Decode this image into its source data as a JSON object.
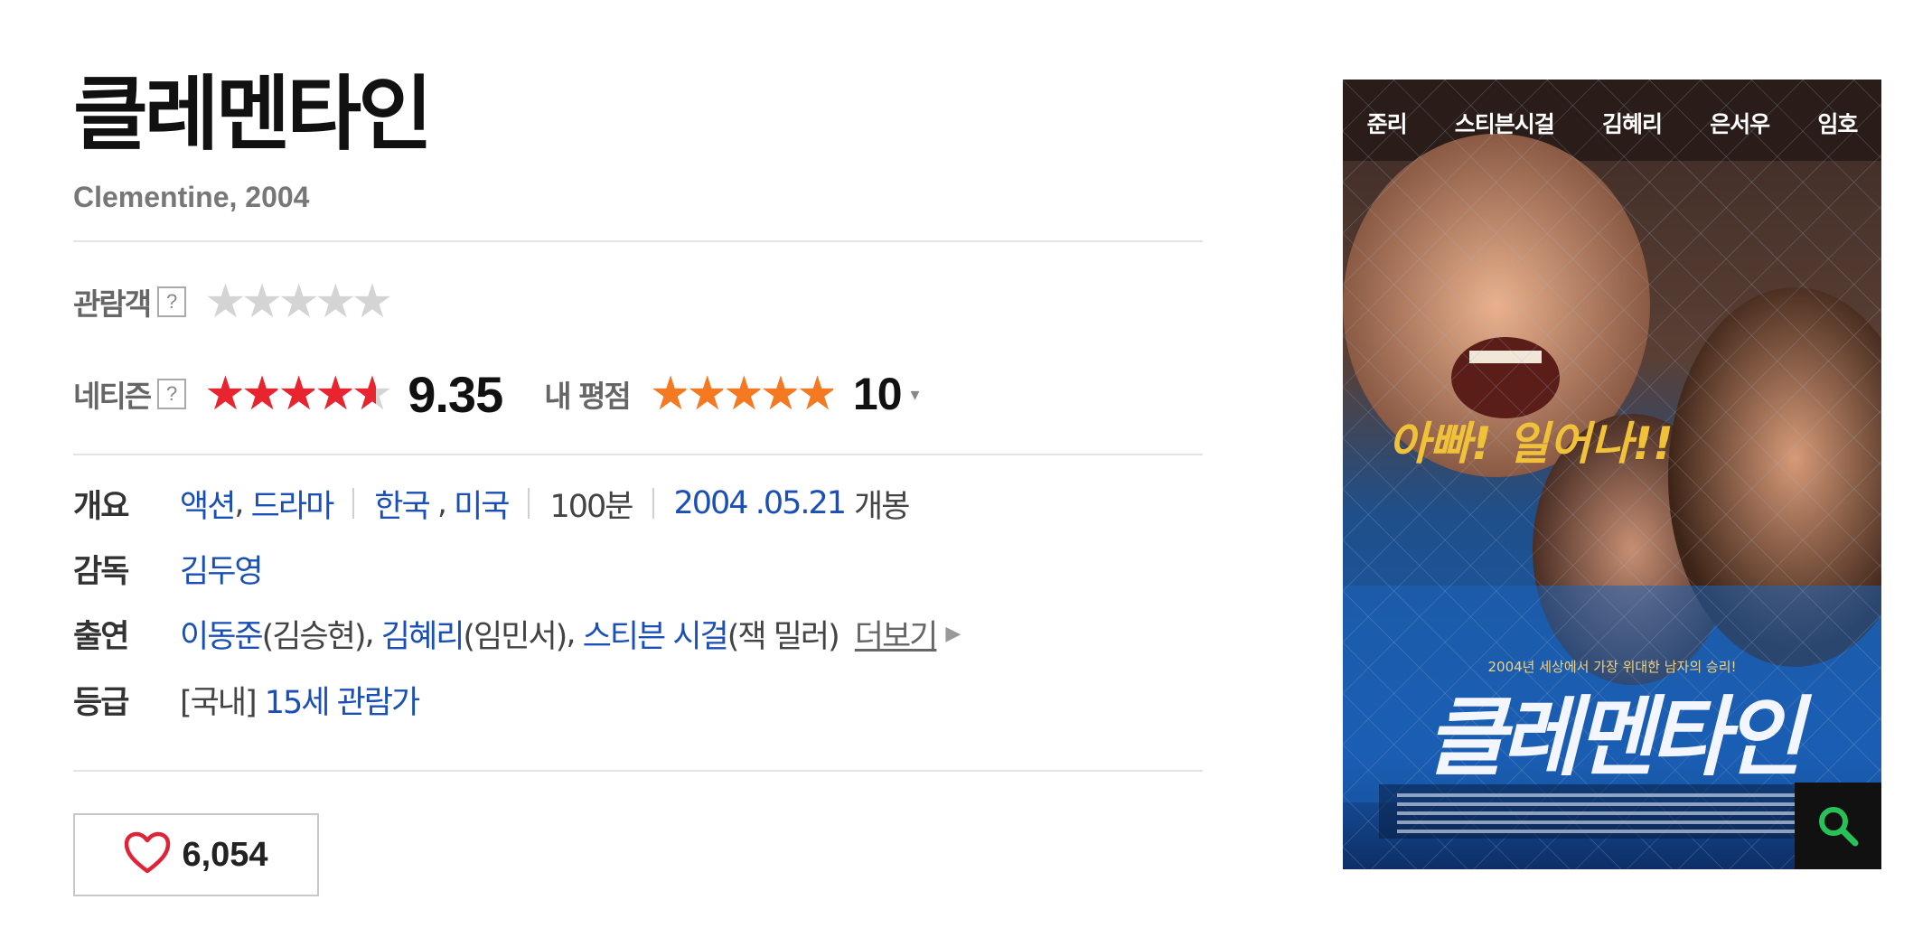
{
  "movie": {
    "title": "클레멘타인",
    "subtitle": "Clementine, 2004"
  },
  "ratings": {
    "audience_label": "관람객",
    "help_glyph": "?",
    "audience_rating": 0,
    "netizen_label": "네티즌",
    "netizen_rating": 9.35,
    "netizen_score_text": "9.35",
    "my_label": "내 평점",
    "my_rating": 10,
    "my_score_text": "10",
    "star_glyph": "★",
    "dropdown_glyph": "▾"
  },
  "info": {
    "overview_label": "개요",
    "genre_1": "액션",
    "genre_2": "드라마",
    "country_1": "한국",
    "country_2": "미국",
    "runtime": "100분",
    "release_date": "2004 .05.21",
    "release_suffix": "개봉",
    "director_label": "감독",
    "director": "김두영",
    "cast_label": "출연",
    "cast": [
      {
        "actor": "이동준",
        "role": "(김승현)"
      },
      {
        "actor": "김혜리",
        "role": "(임민서)"
      },
      {
        "actor": "스티븐 시걸",
        "role": "(잭 밀러)"
      }
    ],
    "more_label": "더보기",
    "rating_label": "등급",
    "rating_domestic": "[국내]",
    "rating_value": "15세 관람가"
  },
  "like": {
    "count": "6,054"
  },
  "poster": {
    "cast_names": [
      "준리",
      "스티븐시걸",
      "김혜리",
      "은서우",
      "임호"
    ],
    "tagline": "아빠! 일어나!!",
    "subline": "2004년 세상에서 가장 위대한 남자의 승리!",
    "title": "클레멘타인"
  },
  "colors": {
    "link": "#1a4fb8",
    "star_red": "#e8242f",
    "star_orange": "#f47920",
    "star_empty": "#d4d4d4",
    "heart": "#e02437",
    "zoom_icon": "#28c157"
  }
}
